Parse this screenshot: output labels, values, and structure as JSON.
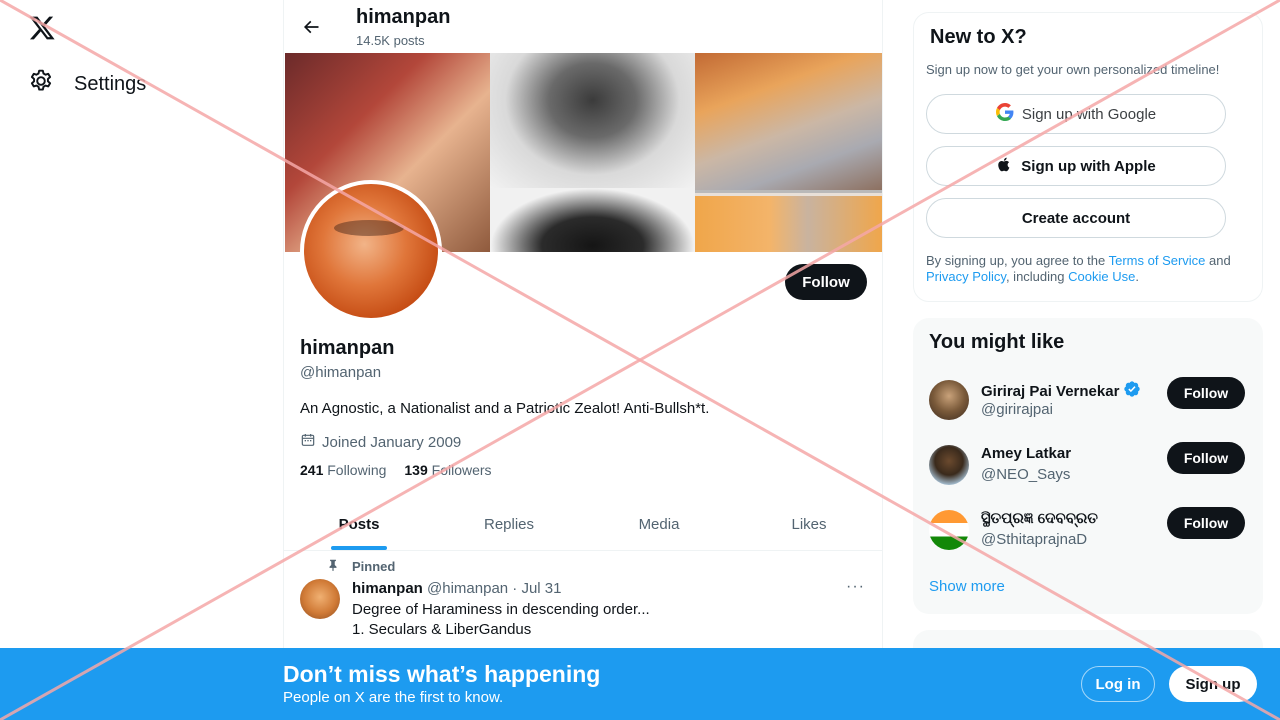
{
  "nav": {
    "settings_label": "Settings"
  },
  "header": {
    "name": "himanpan",
    "posts_count": "14.5K posts"
  },
  "profile": {
    "follow_label": "Follow",
    "name": "himanpan",
    "handle": "@himanpan",
    "bio": "An Agnostic, a Nationalist and a Patriotic Zealot! Anti-Bullsh*t.",
    "joined": "Joined January 2009",
    "following_count": "241",
    "following_label": "Following",
    "followers_count": "139",
    "followers_label": "Followers"
  },
  "tabs": [
    {
      "label": "Posts",
      "active": true
    },
    {
      "label": "Replies",
      "active": false
    },
    {
      "label": "Media",
      "active": false
    },
    {
      "label": "Likes",
      "active": false
    }
  ],
  "pinned_tweet": {
    "pinned_label": "Pinned",
    "author_name": "himanpan",
    "author_handle": "@himanpan",
    "separator": "·",
    "date": "Jul 31",
    "more_label": "···",
    "lines": [
      "Degree of Haraminess in descending order...",
      "1. Seculars & LiberGandus"
    ]
  },
  "new_to_x": {
    "title": "New to X?",
    "subtitle": "Sign up now to get your own personalized timeline!",
    "google_label": "Sign up with Google",
    "apple_label": "Sign up with Apple",
    "create_label": "Create account",
    "legal_prefix": "By signing up, you agree to the ",
    "terms_link": "Terms of Service",
    "legal_and": " and ",
    "privacy_link": "Privacy Policy",
    "legal_including": ", including ",
    "cookie_link": "Cookie Use",
    "legal_suffix": "."
  },
  "might_like": {
    "title": "You might like",
    "follow_label": "Follow",
    "show_more": "Show more",
    "users": [
      {
        "name": "Giriraj Pai Vernekar",
        "handle": "@girirajpai",
        "verified": true
      },
      {
        "name": "Amey Latkar",
        "handle": "@NEO_Says",
        "verified": false
      },
      {
        "name": "ସ୍ଥିତପ୍ରଜ୍ଞ ଦେବବ୍ରତ",
        "handle": "@SthitaprajnaD",
        "verified": false
      }
    ]
  },
  "bottom_bar": {
    "title": "Don’t miss what’s happening",
    "subtitle": "People on X are the first to know.",
    "login_label": "Log in",
    "signup_label": "Sign up"
  },
  "colors": {
    "accent": "#1d9bf0",
    "dark": "#0f1419",
    "muted": "#536471",
    "overlay_cross": "#f4a7a7"
  }
}
